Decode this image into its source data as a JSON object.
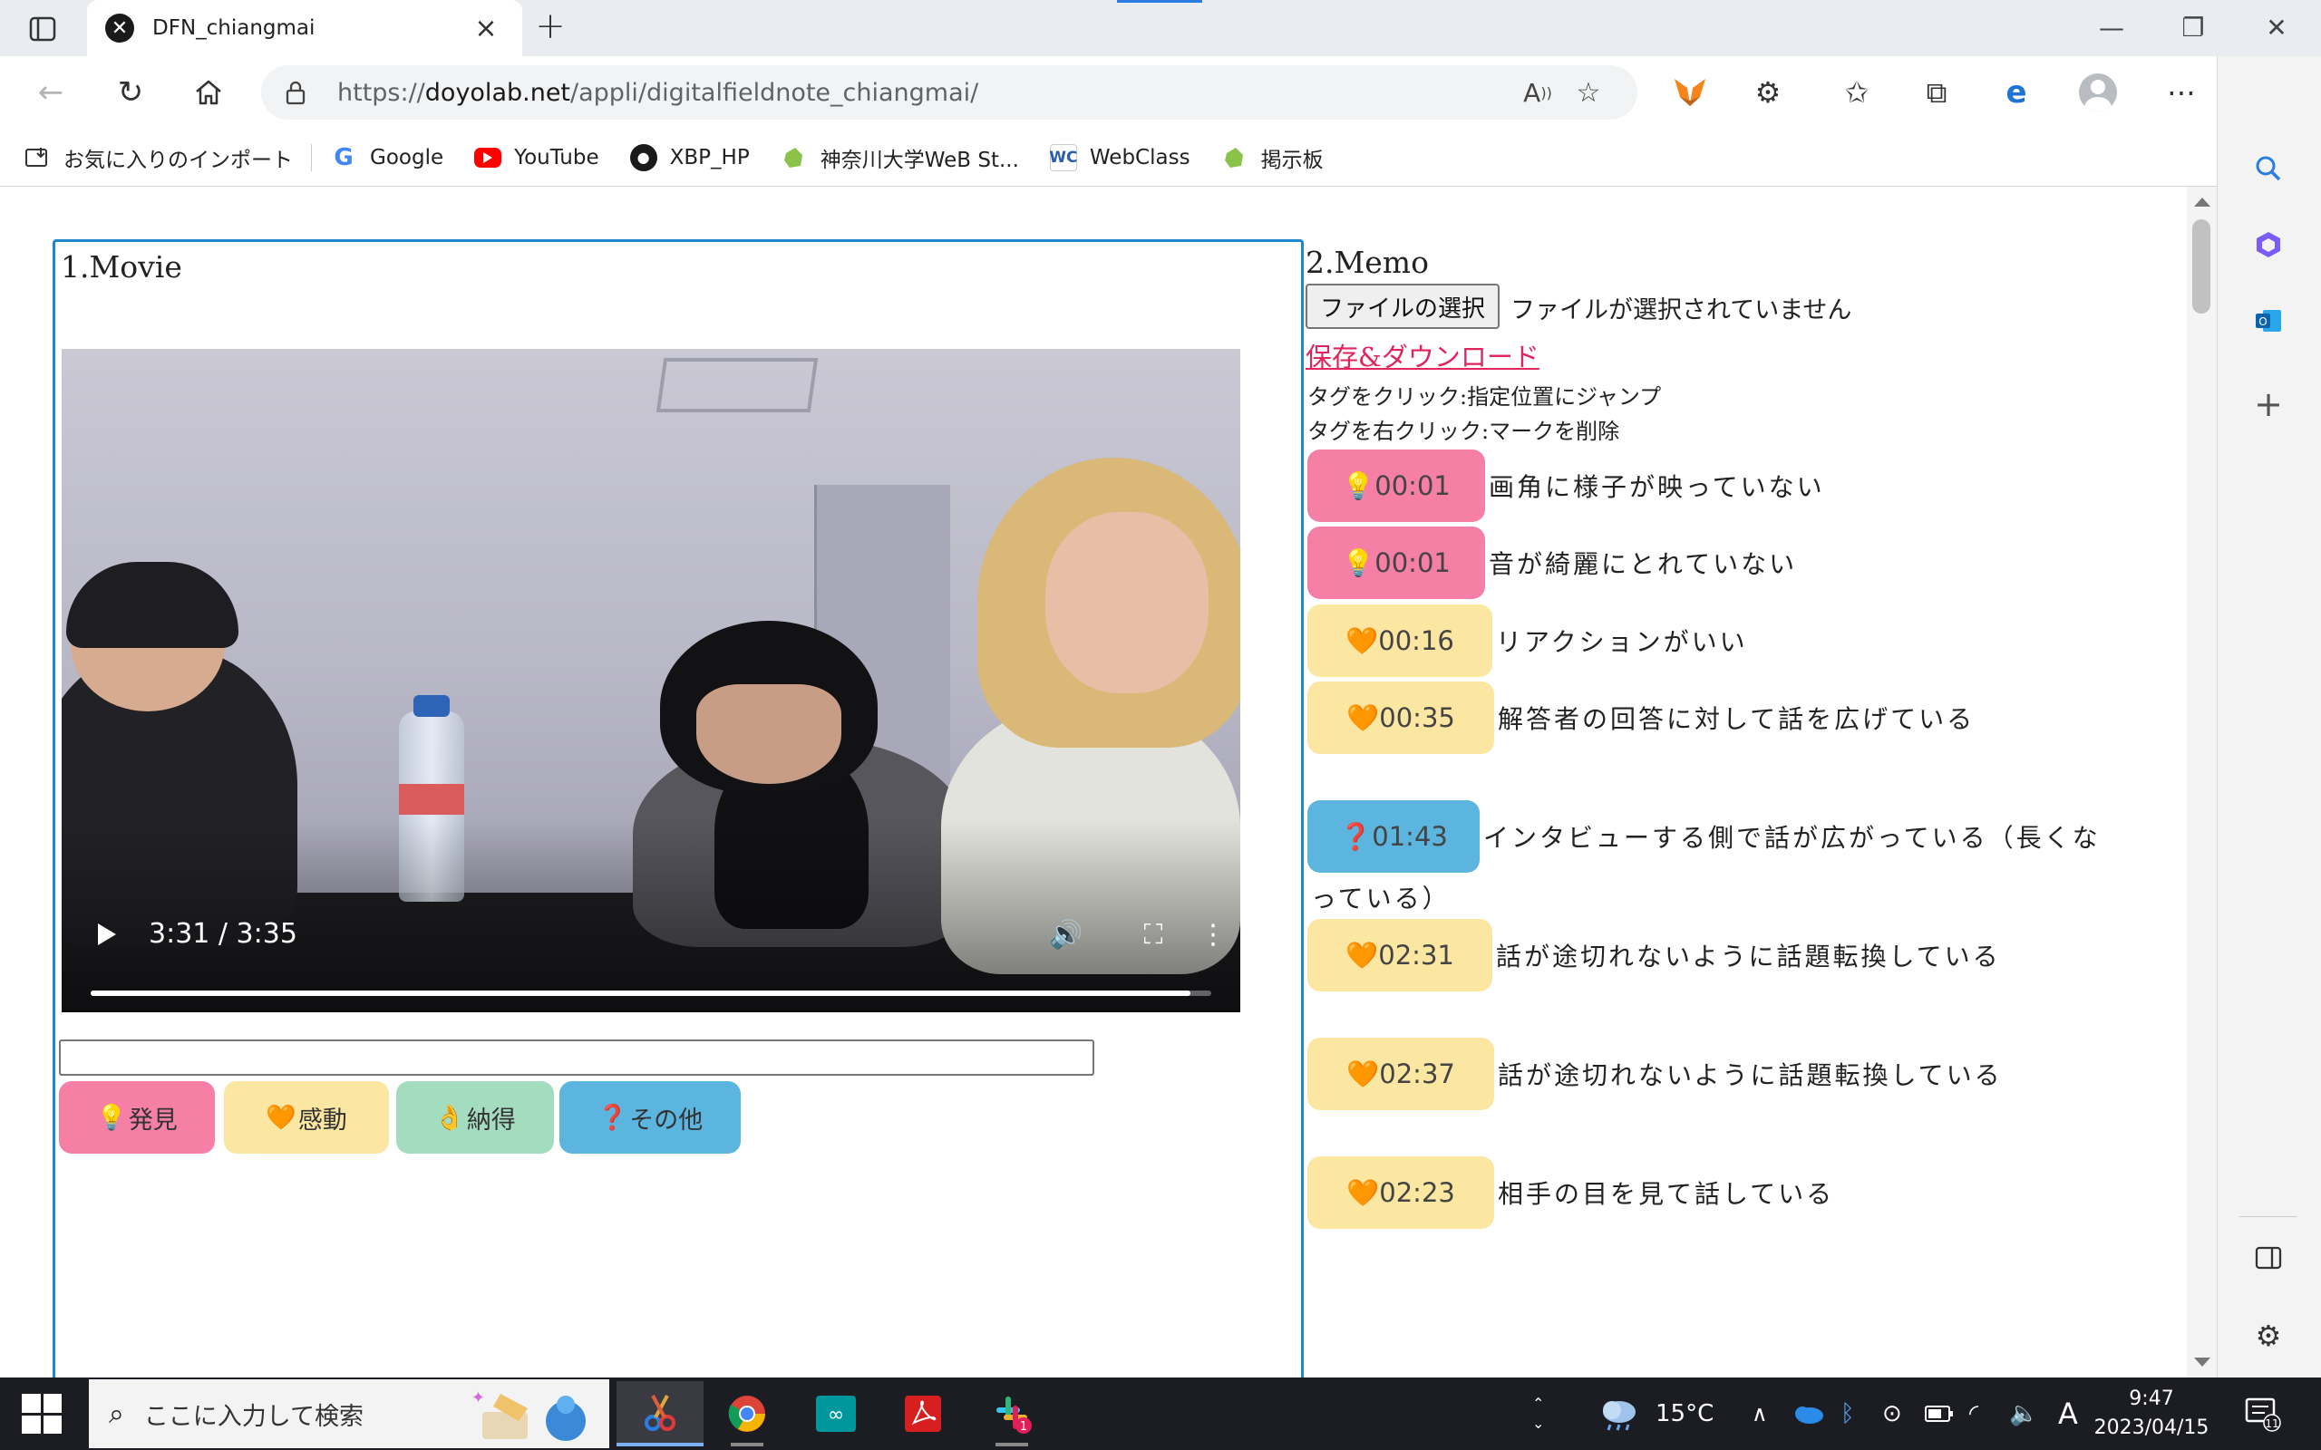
{
  "browser": {
    "tab_title": "DFN_chiangmai",
    "url_prefix": "https://",
    "url_host": "doyolab.net",
    "url_path": "/appli/digitalfieldnote_chiangmai/",
    "favorites": [
      {
        "label": "お気に入りのインポート",
        "icon": "import-icon"
      },
      {
        "label": "Google",
        "icon": "google-icon",
        "color": "#4285f4"
      },
      {
        "label": "YouTube",
        "icon": "youtube-icon",
        "color": "#ff0000"
      },
      {
        "label": "XBP_HP",
        "icon": "github-icon",
        "color": "#1a1a1a"
      },
      {
        "label": "神奈川大学WeB St...",
        "icon": "leaf-icon",
        "color": "#8bc34a"
      },
      {
        "label": "WebClass",
        "icon": "webclass-icon",
        "color": "#2a5db0"
      },
      {
        "label": "掲示板",
        "icon": "leaf-icon",
        "color": "#8bc34a"
      }
    ]
  },
  "page": {
    "movie_title": "1.Movie",
    "memo_title": "2.Memo",
    "video": {
      "time": "3:31 / 3:35",
      "progress": 0.981
    },
    "tag_buttons": [
      {
        "icon": "💡",
        "label": "発見",
        "color": "#f67fa5"
      },
      {
        "icon": "🧡",
        "label": "感動",
        "color": "#fbe6a2"
      },
      {
        "icon": "👌",
        "label": "納得",
        "color": "#a4dcc0"
      },
      {
        "icon": "❓",
        "label": "その他",
        "color": "#5cb5df"
      }
    ],
    "file_button": "ファイルの選択",
    "file_status": "ファイルが選択されていません",
    "save_link": "保存&ダウンロード",
    "hint_click": "タグをクリック:指定位置にジャンプ",
    "hint_right_click": "タグを右クリック:マークを削除",
    "memos": [
      {
        "icon": "💡",
        "time": "00:01",
        "text": "画角に様子が映っていない",
        "color": "#f67fa5"
      },
      {
        "icon": "💡",
        "time": "00:01",
        "text": "音が綺麗にとれていない",
        "color": "#f67fa5"
      },
      {
        "icon": "🧡",
        "time": "00:16",
        "text": "リアクションがいい",
        "color": "#fbe6a2"
      },
      {
        "icon": "🧡",
        "time": "00:35",
        "text": "解答者の回答に対して話を広げている",
        "color": "#fbe6a2"
      },
      {
        "icon": "❓",
        "time": "01:43",
        "text": "インタビューする側で話が広がっている（長くな",
        "text_cont": "っている）",
        "color": "#5cb5df"
      },
      {
        "icon": "🧡",
        "time": "02:31",
        "text": "話が途切れないように話題転換している",
        "color": "#fbe6a2"
      },
      {
        "icon": "🧡",
        "time": "02:37",
        "text": "話が途切れないように話題転換している",
        "color": "#fbe6a2"
      },
      {
        "icon": "🧡",
        "time": "02:23",
        "text": "相手の目を見て話している",
        "color": "#fbe6a2"
      }
    ]
  },
  "taskbar": {
    "search_placeholder": "ここに入力して検索",
    "weather": "15°C",
    "ime": "A",
    "time": "9:47",
    "date": "2023/04/15",
    "notifications": "11",
    "slack_badge": "1"
  }
}
